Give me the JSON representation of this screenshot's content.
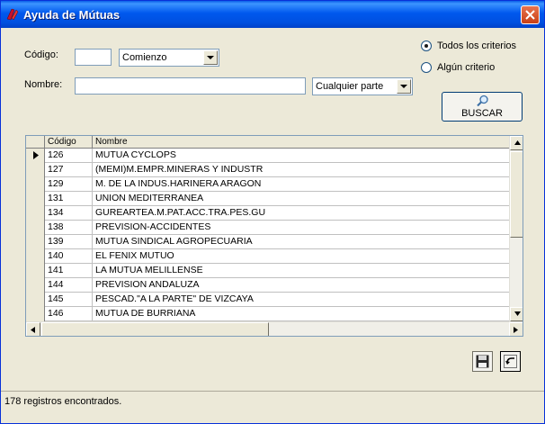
{
  "window": {
    "title": "Ayuda de Mútuas",
    "accent": "#0058EE"
  },
  "form": {
    "codigo_label": "Código:",
    "codigo_value": "",
    "codigo_match": "Comienzo",
    "nombre_label": "Nombre:",
    "nombre_value": "",
    "nombre_match": "Cualquier parte",
    "radio_all_label": "Todos los criterios",
    "radio_any_label": "Algún criterio",
    "selected_radio": "all",
    "search_button_label": "BUSCAR"
  },
  "grid": {
    "columns": [
      "Código",
      "Nombre"
    ],
    "rows": [
      {
        "codigo": "126",
        "nombre": "MUTUA CYCLOPS",
        "current": true
      },
      {
        "codigo": "127",
        "nombre": "(MEMI)M.EMPR.MINERAS Y INDUSTR"
      },
      {
        "codigo": "129",
        "nombre": "M. DE LA INDUS.HARINERA ARAGON"
      },
      {
        "codigo": "131",
        "nombre": "UNION MEDITERRANEA"
      },
      {
        "codigo": "134",
        "nombre": "GUREARTEA.M.PAT.ACC.TRA.PES.GU"
      },
      {
        "codigo": "138",
        "nombre": "PREVISION-ACCIDENTES"
      },
      {
        "codigo": "139",
        "nombre": "MUTUA SINDICAL AGROPECUARIA"
      },
      {
        "codigo": "140",
        "nombre": "EL FENIX MUTUO"
      },
      {
        "codigo": "141",
        "nombre": "LA MUTUA MELILLENSE"
      },
      {
        "codigo": "144",
        "nombre": "PREVISION ANDALUZA"
      },
      {
        "codigo": "145",
        "nombre": "PESCAD.\"A LA PARTE\" DE VIZCAYA"
      },
      {
        "codigo": "146",
        "nombre": "MUTUA DE BURRIANA"
      }
    ]
  },
  "status": {
    "text": "178 registros encontrados."
  },
  "icons": {
    "app": "app-icon",
    "close": "close-icon",
    "search": "magnifier-icon",
    "save": "floppy-disk-icon",
    "undo": "undo-arrow-icon"
  }
}
